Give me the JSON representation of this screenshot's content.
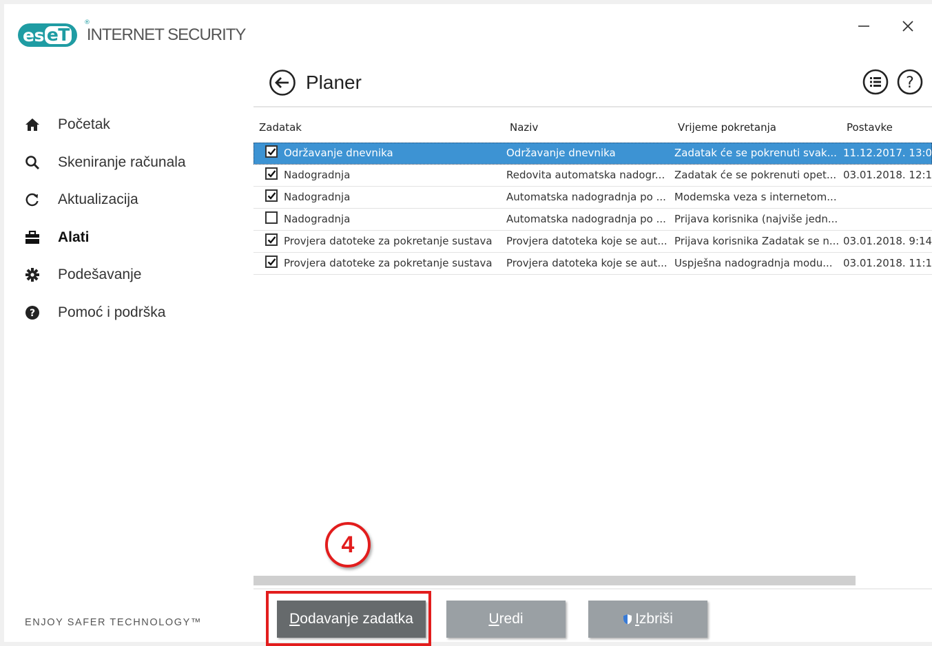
{
  "app": {
    "logo_text_1": "es",
    "logo_text_2": "eT",
    "logo_reg": "®",
    "product_name": "INTERNET SECURITY"
  },
  "window_controls": {
    "minimize": "–",
    "close": "✕"
  },
  "sidebar": {
    "items": [
      {
        "label": "Početak",
        "icon": "home-icon",
        "active": false
      },
      {
        "label": "Skeniranje računala",
        "icon": "search-icon",
        "active": false
      },
      {
        "label": "Aktualizacija",
        "icon": "refresh-icon",
        "active": false
      },
      {
        "label": "Alati",
        "icon": "toolbox-icon",
        "active": true
      },
      {
        "label": "Podešavanje",
        "icon": "gear-icon",
        "active": false
      },
      {
        "label": "Pomoć i podrška",
        "icon": "help-icon",
        "active": false
      }
    ],
    "tagline": "ENJOY SAFER TECHNOLOGY™"
  },
  "header": {
    "title": "Planer",
    "back_icon": "back-arrow-icon",
    "menu_icon": "list-icon",
    "help_icon": "help-icon"
  },
  "table": {
    "columns": [
      "Zadatak",
      "Naziv",
      "Vrijeme pokretanja",
      "Postavke"
    ],
    "rows": [
      {
        "checked": true,
        "selected": true,
        "task": "Održavanje dnevnika",
        "name": "Održavanje dnevnika",
        "time": "Zadatak će se pokrenuti svak...",
        "settings": "11.12.2017. 13:0"
      },
      {
        "checked": true,
        "selected": false,
        "task": "Nadogradnja",
        "name": "Redovita automatska nadogr...",
        "time": "Zadatak će se pokrenuti opet...",
        "settings": "03.01.2018. 12:1"
      },
      {
        "checked": true,
        "selected": false,
        "task": "Nadogradnja",
        "name": "Automatska nadogradnja po ...",
        "time": "Modemska veza s internetom...",
        "settings": ""
      },
      {
        "checked": false,
        "selected": false,
        "task": "Nadogradnja",
        "name": "Automatska nadogradnja po ...",
        "time": "Prijava korisnika (najviše jedn...",
        "settings": ""
      },
      {
        "checked": true,
        "selected": false,
        "task": "Provjera datoteke za pokretanje sustava",
        "name": "Provjera datoteka koje se aut...",
        "time": "Prijava korisnika Zadatak se n...",
        "settings": "03.01.2018. 9:14"
      },
      {
        "checked": true,
        "selected": false,
        "task": "Provjera datoteke za pokretanje sustava",
        "name": "Provjera datoteka koje se aut...",
        "time": "Uspješna nadogradnja modu...",
        "settings": "03.01.2018. 11:1"
      }
    ]
  },
  "annotation": {
    "step": "4"
  },
  "buttons": {
    "add": {
      "mnemonic": "D",
      "rest": "odavanje zadatka"
    },
    "edit": {
      "mnemonic": "U",
      "rest": "redi"
    },
    "delete": {
      "mnemonic": "I",
      "rest": "zbriši",
      "icon": "shield-icon"
    }
  },
  "colors": {
    "brand": "#1f9ca3",
    "selection": "#3d93d3",
    "annotation": "#e21d1d"
  }
}
